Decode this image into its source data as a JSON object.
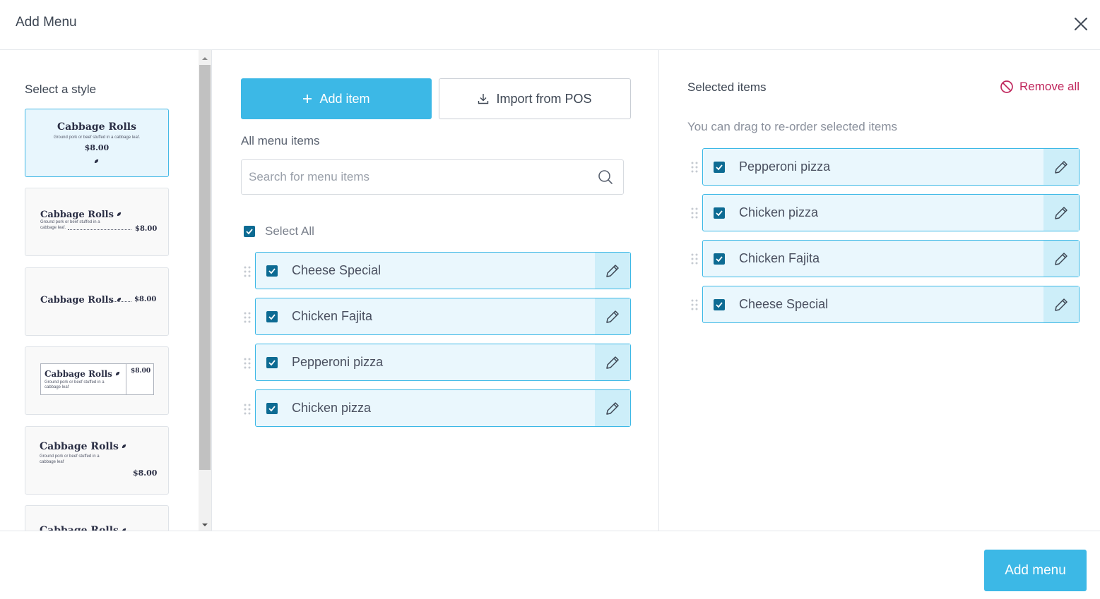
{
  "dialog": {
    "title": "Add Menu",
    "close_icon": "close-icon"
  },
  "style_panel": {
    "title": "Select a style",
    "sample": {
      "name": "Cabbage Rolls",
      "description_short": "Ground pork or beef stuffed in a cabbage leaf.",
      "description_a": "Ground pork or beef stuffed in a",
      "description_b": "cabbage leaf",
      "description_b_dot": "cabbage leaf.",
      "price": "$8.00"
    },
    "selected_index": 0,
    "scrollbar": {
      "thumb_fraction": 0.84
    }
  },
  "middle": {
    "add_item_label": "Add item",
    "import_label": "Import from POS",
    "section_label": "All menu items",
    "search_placeholder": "Search for menu items",
    "select_all_label": "Select All",
    "items": [
      {
        "label": "Cheese Special",
        "checked": true
      },
      {
        "label": "Chicken Fajita",
        "checked": true
      },
      {
        "label": "Pepperoni pizza",
        "checked": true
      },
      {
        "label": "Chicken pizza",
        "checked": true
      }
    ]
  },
  "right": {
    "title": "Selected items",
    "remove_all_label": "Remove all",
    "hint": "You can drag to re-order selected items",
    "items": [
      {
        "label": "Pepperoni pizza",
        "checked": true
      },
      {
        "label": "Chicken pizza",
        "checked": true
      },
      {
        "label": "Chicken Fajita",
        "checked": true
      },
      {
        "label": "Cheese Special",
        "checked": true
      }
    ]
  },
  "footer": {
    "add_menu_label": "Add menu"
  },
  "colors": {
    "accent": "#3cb8e6",
    "checkbox": "#0d6b93",
    "danger": "#c0275d",
    "row_bg": "#eaf7fd",
    "edit_bg": "#cdeef9"
  }
}
